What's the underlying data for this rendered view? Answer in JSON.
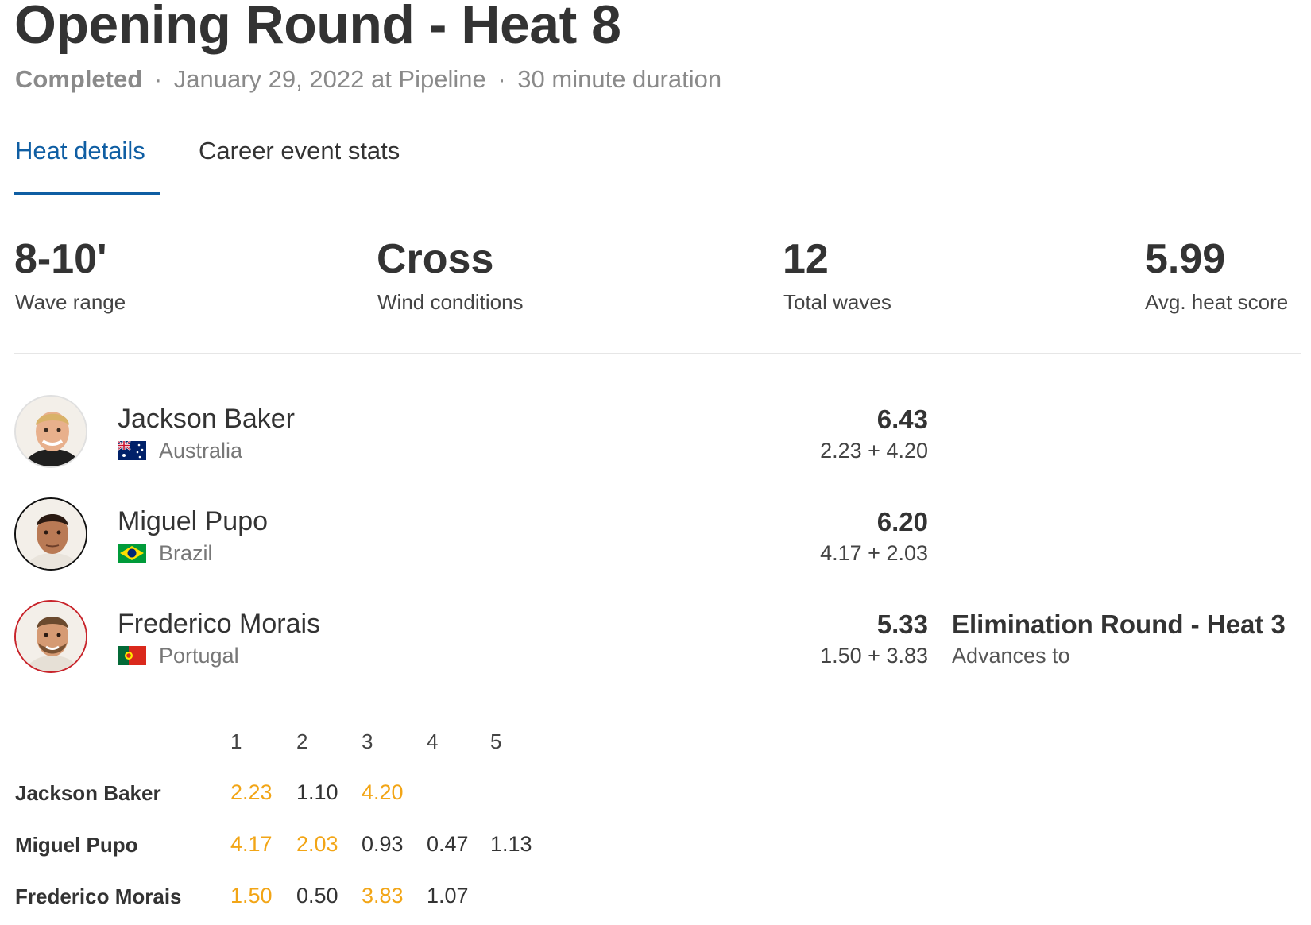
{
  "heat": {
    "title": "Opening Round - Heat 8",
    "status": "Completed",
    "sep1": "·",
    "date_location": "January 29, 2022 at Pipeline",
    "sep2": "·",
    "duration": "30 minute duration"
  },
  "tabs": [
    {
      "label": "Heat details",
      "active": true
    },
    {
      "label": "Career event stats",
      "active": false
    }
  ],
  "stats": [
    {
      "value": "8-10'",
      "label": "Wave range"
    },
    {
      "value": "Cross",
      "label": "Wind conditions"
    },
    {
      "value": "12",
      "label": "Total waves"
    },
    {
      "value": "5.99",
      "label": "Avg. heat score"
    }
  ],
  "surfers": [
    {
      "name": "Jackson Baker",
      "country": "Australia",
      "flag": "australia-flag",
      "total": "6.43",
      "waves_sum": "2.23 + 4.20",
      "avatar_border": "#e0e0e0"
    },
    {
      "name": "Miguel Pupo",
      "country": "Brazil",
      "flag": "brazil-flag",
      "total": "6.20",
      "waves_sum": "4.17 + 2.03",
      "avatar_border": "#111111"
    },
    {
      "name": "Frederico Morais",
      "country": "Portugal",
      "flag": "portugal-flag",
      "total": "5.33",
      "waves_sum": "1.50 + 3.83",
      "avatar_border": "#c8242b",
      "advance": {
        "title": "Elimination Round - Heat 3",
        "label": "Advances to"
      }
    }
  ],
  "wave_table": {
    "headers": [
      "1",
      "2",
      "3",
      "4",
      "5"
    ],
    "rows": [
      {
        "name": "Jackson Baker",
        "scores": [
          "2.23",
          "1.10",
          "4.20"
        ],
        "counted": [
          0,
          2
        ]
      },
      {
        "name": "Miguel Pupo",
        "scores": [
          "4.17",
          "2.03",
          "0.93",
          "0.47",
          "1.13"
        ],
        "counted": [
          0,
          1
        ]
      },
      {
        "name": "Frederico Morais",
        "scores": [
          "1.50",
          "0.50",
          "3.83",
          "1.07"
        ],
        "counted": [
          0,
          2
        ]
      }
    ]
  },
  "colors": {
    "accent": "#0f5ea3",
    "counted_score": "#f2a516",
    "divider": "#e6e6e6"
  }
}
